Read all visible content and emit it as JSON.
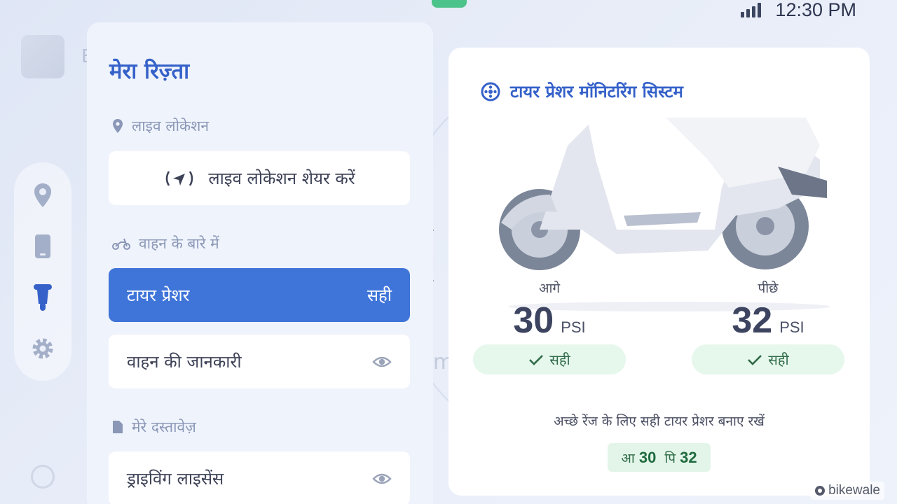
{
  "status": {
    "time": "12:30 PM"
  },
  "rail": {
    "items": [
      "location-pin-icon",
      "phone-icon",
      "scooter-icon",
      "gear-icon"
    ]
  },
  "panel": {
    "title": "मेरा रिज़्ता",
    "live_section": "लाइव लोकेशन",
    "share_label": "लाइव लोकेशन शेयर करें",
    "vehicle_section": "वाहन के बारे में",
    "tyre_label": "टायर प्रेशर",
    "tyre_status": "सही",
    "vehicle_info_label": "वाहन की जानकारी",
    "docs_section": "मेरे दस्तावेज़",
    "license_label": "ड्राइविंग लाइसेंस"
  },
  "tpms": {
    "title": "टायर प्रेशर मॉनिटरिंग सिस्टम",
    "front": {
      "label": "आगे",
      "value": "30",
      "unit": "PSI",
      "status": "सही"
    },
    "rear": {
      "label": "पीछे",
      "value": "32",
      "unit": "PSI",
      "status": "सही"
    },
    "hint": "अच्छे रेंज के लिए सही टायर प्रेशर बनाए रखें",
    "mini_front_prefix": "आ",
    "mini_front_value": "30",
    "mini_rear_prefix": "पि",
    "mini_rear_value": "32"
  },
  "watermark": "bikewale",
  "colors": {
    "accent": "#3f74d8",
    "title": "#3561c9",
    "ok_bg": "#e6f7ec",
    "status_green": "#4cc38a"
  }
}
